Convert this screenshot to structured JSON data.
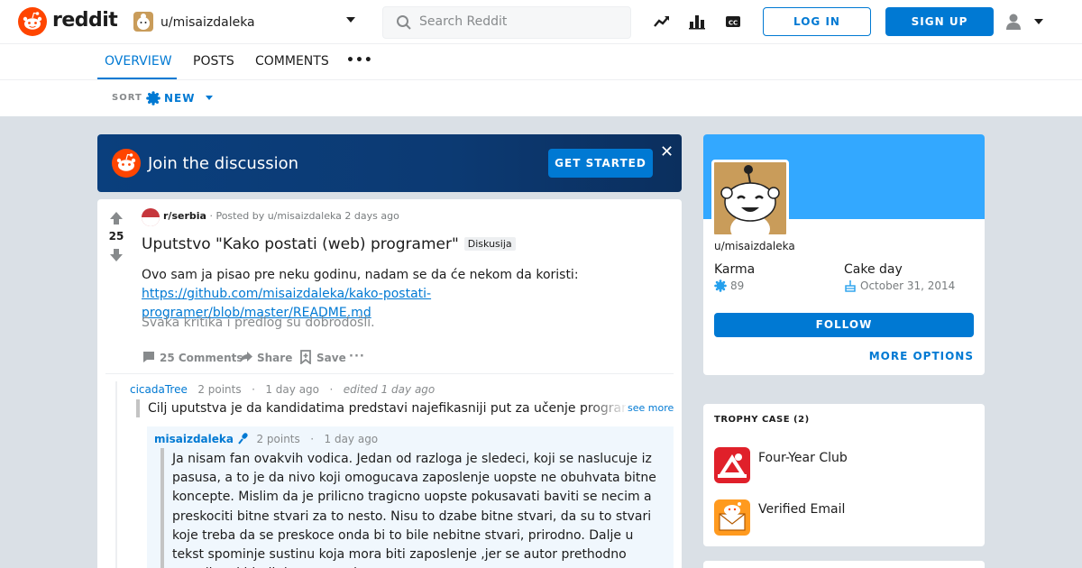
{
  "header": {
    "brand": "reddit",
    "user_dropdown": "u/misaizdaleka",
    "search_placeholder": "Search Reddit",
    "login_label": "LOG IN",
    "signup_label": "SIGN UP",
    "icons": [
      "trending-icon",
      "stats-icon",
      "closed-caption-icon",
      "user-icon",
      "chevron-down-icon"
    ]
  },
  "tabs": [
    {
      "label": "OVERVIEW",
      "active": true
    },
    {
      "label": "POSTS",
      "active": false
    },
    {
      "label": "COMMENTS",
      "active": false
    }
  ],
  "tabs_more": "•••",
  "sort": {
    "label": "SORT",
    "value": "NEW"
  },
  "banner": {
    "text": "Join the discussion",
    "cta": "GET STARTED",
    "close": "✕"
  },
  "post": {
    "score": "25",
    "subreddit": "r/serbia",
    "posted_by": "· Posted by u/misaizdaleka 2 days ago",
    "title": "Uputstvo \"Kako postati (web) programer\"",
    "flair": "Diskusija",
    "body_text": "Ovo sam ja pisao pre neku godinu, nadam se da će nekom da koristi:",
    "body_link": "https://github.com/misaizdaleka/kako-postati-programer/blob/master/README.md",
    "body_text2": "Svaka kritika i predlog su dobrodošli.",
    "comments_label": "25 Comments",
    "share_label": "Share",
    "save_label": "Save",
    "more_label": "···"
  },
  "comment1": {
    "author": "cicadaTree",
    "points": "2 points",
    "sep": "·",
    "time": "1 day ago",
    "edited": "edited 1 day ago",
    "body": "Cilj uputstva je da kandidatima predstavi najefikasniji put za učenje programiranja",
    "see_more": "see more"
  },
  "comment2": {
    "author": "misaizdaleka",
    "points": "2 points",
    "sep": "·",
    "time": "1 day ago",
    "body": "Ja nisam fan ovakvih vodica. Jedan od razloga je sledeci, koji se naslucuje iz pasusa, a to je da nivo koji omogucava zaposlenje uopste ne obuhvata bitne koncepte. Mislim da je prilicno tragicno uopste pokusavati baviti se necim a preskociti bitne stvari za to nesto. Nisu to dzabe bitne stvari, da su to stvari koje treba da se preskoce onda bi to bile nebitne stvari, prirodno. Dalje u tekst spominje sustinu koja mora biti zaposlenje ,jer se autor prethodno ogradio od bitnih koncepata kao"
  },
  "profile": {
    "username": "u/misaizdaleka",
    "karma_label": "Karma",
    "karma_value": "89",
    "cake_label": "Cake day",
    "cake_value": "October 31, 2014",
    "follow_label": "FOLLOW",
    "more_options": "MORE OPTIONS"
  },
  "trophies": {
    "title": "TROPHY CASE (2)",
    "items": [
      {
        "name": "Four-Year Club"
      },
      {
        "name": "Verified Email"
      }
    ]
  },
  "colors": {
    "accent": "#0079d3",
    "brand": "#ff4500",
    "background": "#dae0e6",
    "cover": "#33a8ff"
  }
}
